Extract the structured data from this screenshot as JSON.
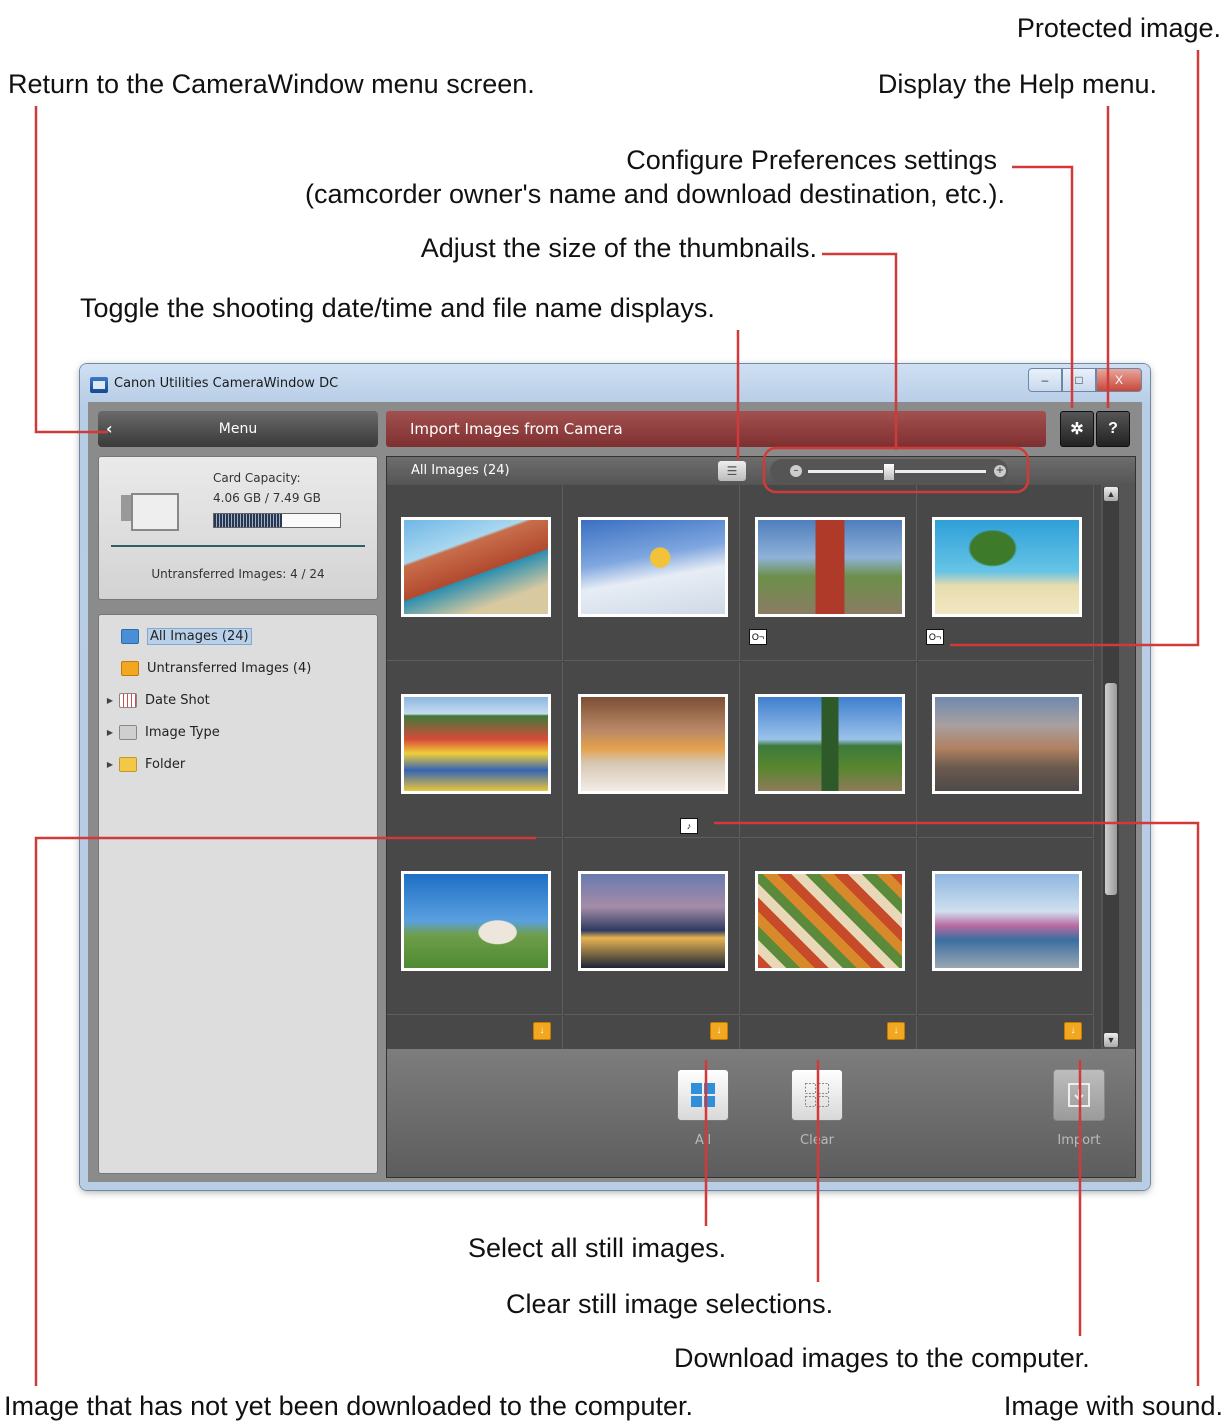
{
  "callouts": {
    "protected": "Protected image.",
    "return_menu": "Return to the CameraWindow menu screen.",
    "help": "Display the Help menu.",
    "prefs_line1": "Configure Preferences settings",
    "prefs_line2": "(camcorder owner's name and download destination, etc.).",
    "thumb_size": "Adjust the size of the thumbnails.",
    "toggle_display": "Toggle the shooting date/time and file name displays.",
    "select_all": "Select all still images.",
    "clear_sel": "Clear still image selections.",
    "download": "Download images to the computer.",
    "not_downloaded": "Image that has not yet been downloaded to the computer.",
    "with_sound": "Image with sound."
  },
  "window": {
    "title": "Canon Utilities CameraWindow DC",
    "min": "–",
    "max": "□",
    "close": "X"
  },
  "header": {
    "menu_label": "Menu",
    "back_glyph": "‹",
    "import_title": "Import Images from Camera",
    "prefs_glyph": "✲",
    "help_glyph": "?"
  },
  "card": {
    "capacity_label": "Card Capacity:",
    "capacity_value": "4.06 GB / 7.49 GB",
    "used_fraction": 0.54,
    "untransferred": "Untransferred Images: 4 / 24"
  },
  "tree": {
    "items": [
      {
        "label": "All Images (24)",
        "icon": "all-images-icon",
        "color": "#4a8fd6"
      },
      {
        "label": "Untransferred Images (4)",
        "icon": "untransferred-icon",
        "color": "#f2a720"
      },
      {
        "label": "Date Shot",
        "icon": "calendar-icon",
        "color": "#c85050"
      },
      {
        "label": "Image Type",
        "icon": "image-type-icon",
        "color": "#bdbdbd"
      },
      {
        "label": "Folder",
        "icon": "folder-icon",
        "color": "#f3c84a"
      }
    ]
  },
  "grid": {
    "header_label": "All Images (24)",
    "list_glyph": "☰",
    "slider_minus": "–",
    "slider_plus": "+",
    "slider_level": 0.45,
    "protected_glyph": "O¬",
    "sound_glyph": "♪",
    "download_glyph": "↓",
    "scroll_up": "▲",
    "scroll_down": "▼"
  },
  "actions": {
    "select_all_label": "All",
    "clear_label": "Clear",
    "import_label": "Import"
  },
  "colors": {
    "accent": "#d23a3a",
    "header_red": "#8e3b3b",
    "select_blue": "#2f8fd8",
    "download_orange": "#f2a720"
  }
}
